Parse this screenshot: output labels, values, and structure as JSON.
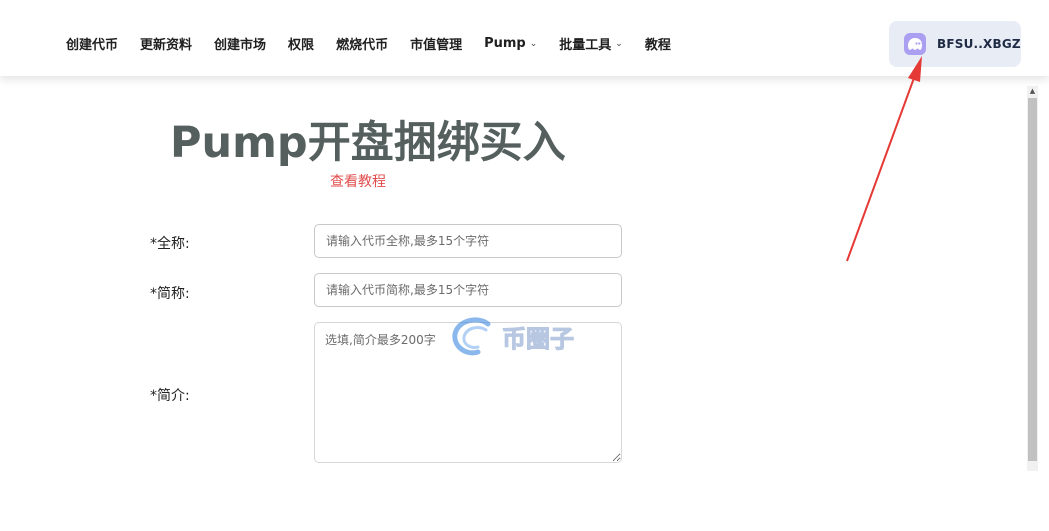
{
  "nav": {
    "items": [
      {
        "label": "创建代币"
      },
      {
        "label": "更新资料"
      },
      {
        "label": "创建市场"
      },
      {
        "label": "权限"
      },
      {
        "label": "燃烧代币"
      },
      {
        "label": "市值管理"
      },
      {
        "label": "Pump",
        "dropdown": true
      },
      {
        "label": "批量工具",
        "dropdown": true
      },
      {
        "label": "教程"
      }
    ],
    "dropdown_icon": "chevron-down-icon"
  },
  "wallet": {
    "label": "BFSU..XBGZ",
    "icon": "phantom-ghost-icon",
    "icon_color": "#ab9ff2"
  },
  "page": {
    "title": "Pump开盘捆绑买入",
    "tutorial_link": "查看教程",
    "title_color": "#555f5e",
    "link_color": "#e24d4d"
  },
  "form": {
    "full_name": {
      "label": "*全称:",
      "placeholder": "请输入代币全称,最多15个字符",
      "value": ""
    },
    "short_name": {
      "label": "*简称:",
      "placeholder": "请输入代币简称,最多15个字符",
      "value": ""
    },
    "description": {
      "label": "*简介:",
      "placeholder": "选填,简介最多200字",
      "value": ""
    }
  },
  "watermark": {
    "text": "币圈子",
    "icon": "circle-logo-icon"
  },
  "annotation": {
    "color": "#e53935"
  }
}
